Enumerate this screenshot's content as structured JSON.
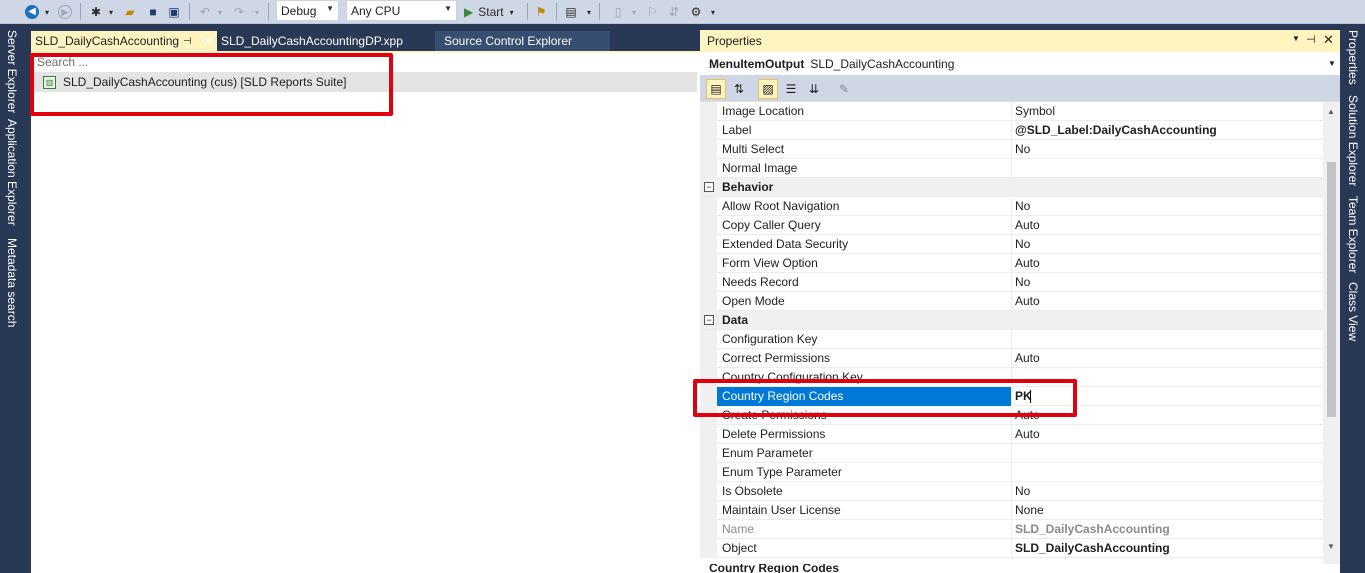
{
  "toolbar": {
    "configuration": "Debug",
    "platform": "Any CPU",
    "start_label": "Start"
  },
  "left_strip": {
    "tabs": [
      "Server Explorer",
      "Application Explorer",
      "Metadata search"
    ]
  },
  "right_strip": {
    "tabs": [
      "Properties",
      "Solution Explorer",
      "Team Explorer",
      "Class View"
    ]
  },
  "doc_tabs": [
    {
      "label": "SLD_DailyCashAccounting",
      "active": true
    },
    {
      "label": "SLD_DailyCashAccountingDP.xpp",
      "active": false
    },
    {
      "label": "Source Control Explorer",
      "active": false
    }
  ],
  "editor": {
    "search_placeholder": "Search ...",
    "tree_item": "SLD_DailyCashAccounting (cus) [SLD Reports Suite]"
  },
  "properties": {
    "title": "Properties",
    "object_type": "MenuItemOutput",
    "object_name": "SLD_DailyCashAccounting",
    "rows": [
      {
        "name": "Image Location",
        "value": "Symbol"
      },
      {
        "name": "Label",
        "value": "@SLD_Label:DailyCashAccounting",
        "bold": true
      },
      {
        "name": "Multi Select",
        "value": "No"
      },
      {
        "name": "Normal Image",
        "value": ""
      },
      {
        "category": "Behavior"
      },
      {
        "name": "Allow Root Navigation",
        "value": "No"
      },
      {
        "name": "Copy Caller Query",
        "value": "Auto"
      },
      {
        "name": "Extended Data Security",
        "value": "No"
      },
      {
        "name": "Form View Option",
        "value": "Auto"
      },
      {
        "name": "Needs Record",
        "value": "No"
      },
      {
        "name": "Open Mode",
        "value": "Auto"
      },
      {
        "category": "Data"
      },
      {
        "name": "Configuration Key",
        "value": ""
      },
      {
        "name": "Correct Permissions",
        "value": "Auto"
      },
      {
        "name": "Country Configuration Key",
        "value": ""
      },
      {
        "name": "Country Region Codes",
        "value": "PK",
        "selected": true
      },
      {
        "name": "Create Permissions",
        "value": "Auto"
      },
      {
        "name": "Delete Permissions",
        "value": "Auto"
      },
      {
        "name": "Enum Parameter",
        "value": ""
      },
      {
        "name": "Enum Type Parameter",
        "value": ""
      },
      {
        "name": "Is Obsolete",
        "value": "No"
      },
      {
        "name": "Maintain User License",
        "value": "None"
      },
      {
        "name": "Name",
        "value": "SLD_DailyCashAccounting",
        "readonly": true
      },
      {
        "name": "Object",
        "value": "SLD_DailyCashAccounting",
        "bold": true
      }
    ],
    "footer": "Country Region Codes"
  },
  "colors": {
    "accent_selected": "#0078d7",
    "highlight_box": "#e0000f",
    "active_tab": "#fff3c0",
    "chrome": "#293955"
  }
}
